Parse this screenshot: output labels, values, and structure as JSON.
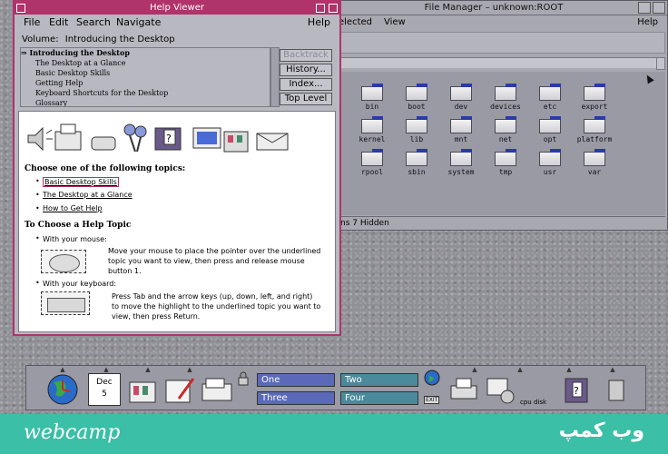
{
  "file_manager": {
    "title": "File Manager – unknown:ROOT",
    "menu": {
      "selected": "elected",
      "view": "View",
      "help": "Help"
    },
    "folders": [
      {
        "name": "bin"
      },
      {
        "name": "boot"
      },
      {
        "name": "dev"
      },
      {
        "name": "devices"
      },
      {
        "name": "etc"
      },
      {
        "name": "export"
      },
      {
        "name": "kernel"
      },
      {
        "name": "lib"
      },
      {
        "name": "mnt"
      },
      {
        "name": "net"
      },
      {
        "name": "opt"
      },
      {
        "name": "platform"
      },
      {
        "name": "rpool"
      },
      {
        "name": "sbin"
      },
      {
        "name": "system"
      },
      {
        "name": "tmp"
      },
      {
        "name": "usr"
      },
      {
        "name": "var"
      }
    ],
    "status": "ns 7 Hidden"
  },
  "help_viewer": {
    "title": "Help Viewer",
    "menu": {
      "file": "File",
      "edit": "Edit",
      "search": "Search",
      "navigate": "Navigate",
      "help": "Help"
    },
    "volume_label": "Volume:",
    "volume_value": "Introducing the Desktop",
    "topics": [
      "Introducing the Desktop",
      "The Desktop at a Glance",
      "Basic Desktop Skills",
      "Getting Help",
      "Keyboard Shortcuts for the Desktop",
      "Glossary"
    ],
    "nav_buttons": {
      "backtrack": "Backtrack",
      "history": "History...",
      "index": "Index...",
      "top_level": "Top Level"
    },
    "choose_heading": "Choose one of the following topics:",
    "links": [
      "Basic Desktop Skills",
      "The Desktop at a Glance",
      "How to Get Help"
    ],
    "choose_topic_heading": "To Choose a Help Topic",
    "with_mouse": "With your mouse:",
    "mouse_text_1": "Move your mouse to place the pointer over the underlined",
    "mouse_text_2": "topic you want to view, then press and release mouse",
    "mouse_text_3": "button 1.",
    "with_keyboard": "With your keyboard:",
    "kbd_text_1": "Press Tab and the arrow keys (up, down, left, and right)",
    "kbd_text_2": "to move the highlight to the underlined topic you want to",
    "kbd_text_3": "view, then press Return."
  },
  "front_panel": {
    "calendar_month": "Dec",
    "calendar_day": "5",
    "workspaces": [
      "One",
      "Two",
      "Three",
      "Four"
    ],
    "exit_label": "EXIT",
    "cpu_disk": "cpu disk"
  },
  "banner": {
    "left": "webcamp",
    "right": "وب کمپ"
  }
}
